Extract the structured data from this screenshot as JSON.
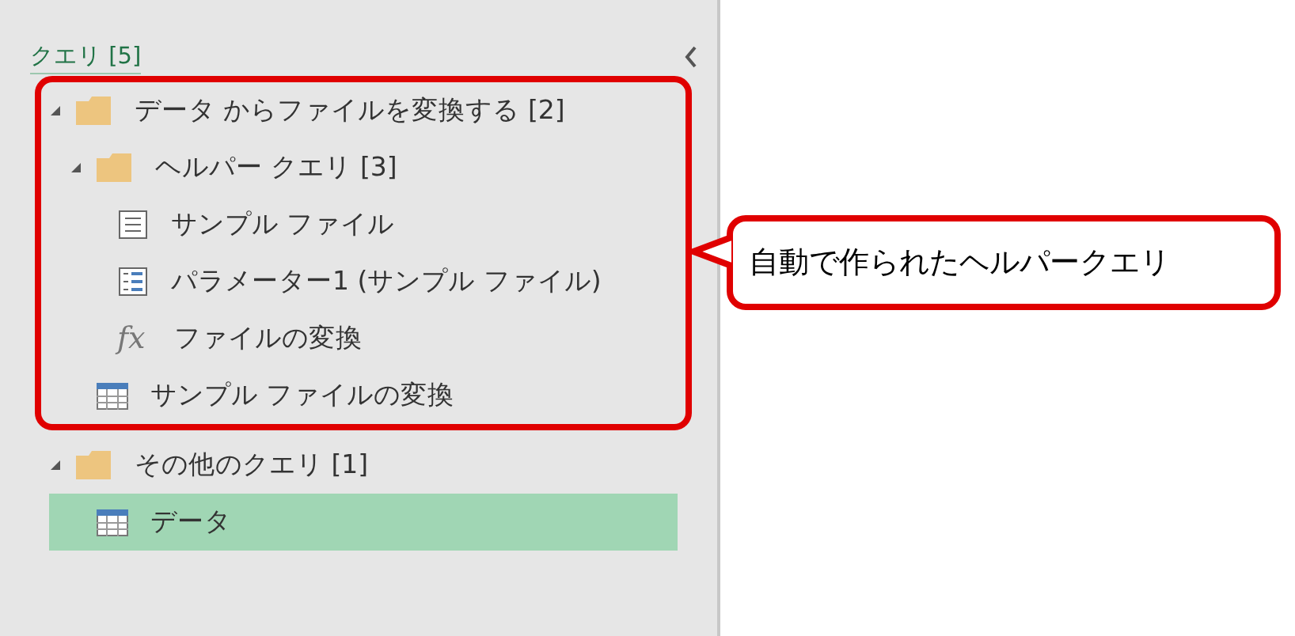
{
  "pane": {
    "title": "クエリ [5]"
  },
  "items": [
    {
      "kind": "folder",
      "label": "データ からファイルを変換する [2]",
      "expanded": true,
      "highlighted": true,
      "selected": false,
      "children": [
        {
          "kind": "folder",
          "label": "ヘルパー クエリ [3]",
          "expanded": true,
          "selected": false,
          "children": [
            {
              "kind": "file",
              "label": "サンプル ファイル",
              "selected": false
            },
            {
              "kind": "parameter",
              "label": "パラメーター1 (サンプル ファイル)",
              "selected": false
            },
            {
              "kind": "function",
              "icon_text": "fx",
              "label": "ファイルの変換",
              "selected": false
            }
          ]
        },
        {
          "kind": "table",
          "label": "サンプル ファイルの変換",
          "selected": false
        }
      ]
    },
    {
      "kind": "folder",
      "label": "その他のクエリ [1]",
      "expanded": true,
      "highlighted": false,
      "selected": false,
      "children": [
        {
          "kind": "table",
          "label": "データ",
          "selected": true
        }
      ]
    }
  ],
  "callout": {
    "text": "自動で作られたヘルパークエリ"
  }
}
